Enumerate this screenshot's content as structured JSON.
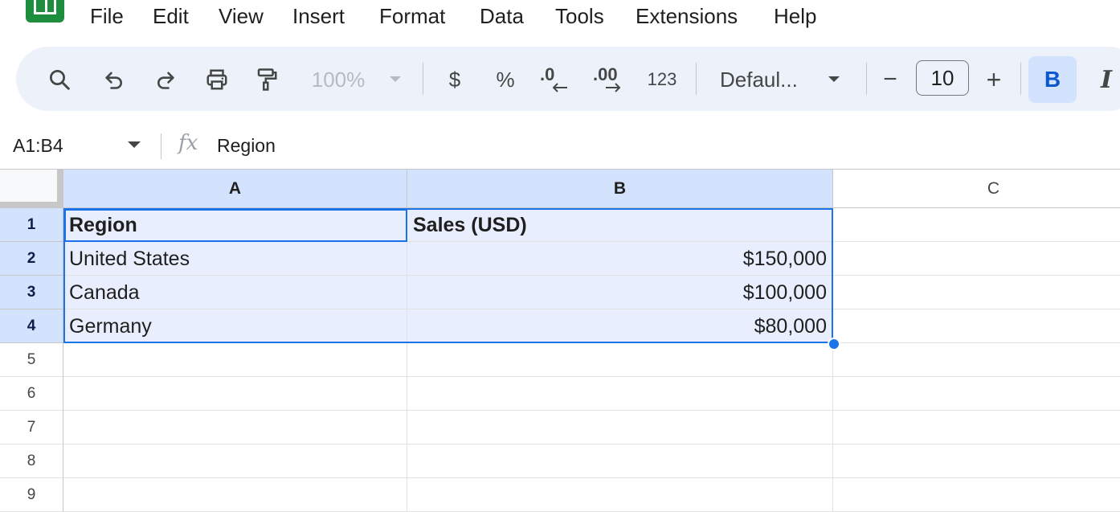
{
  "menu": [
    "File",
    "Edit",
    "View",
    "Insert",
    "Format",
    "Data",
    "Tools",
    "Extensions",
    "Help"
  ],
  "toolbar": {
    "zoom": "100%",
    "currency": "$",
    "percent": "%",
    "decrease_decimal": ".0",
    "increase_decimal": ".00",
    "number_format": "123",
    "font_name": "Defaul...",
    "font_size": "10",
    "minus": "−",
    "plus": "+",
    "bold": "B",
    "italic": "I"
  },
  "formula_bar": {
    "name_box": "A1:B4",
    "fx": "fx",
    "content": "Region"
  },
  "columns": [
    "A",
    "B",
    "C"
  ],
  "rows": [
    "1",
    "2",
    "3",
    "4",
    "5",
    "6",
    "7",
    "8",
    "9"
  ],
  "cells": [
    {
      "a": "Region",
      "b": "Sales (USD)"
    },
    {
      "a": "United States",
      "b": "$150,000"
    },
    {
      "a": "Canada",
      "b": "$100,000"
    },
    {
      "a": "Germany",
      "b": "$80,000"
    }
  ]
}
